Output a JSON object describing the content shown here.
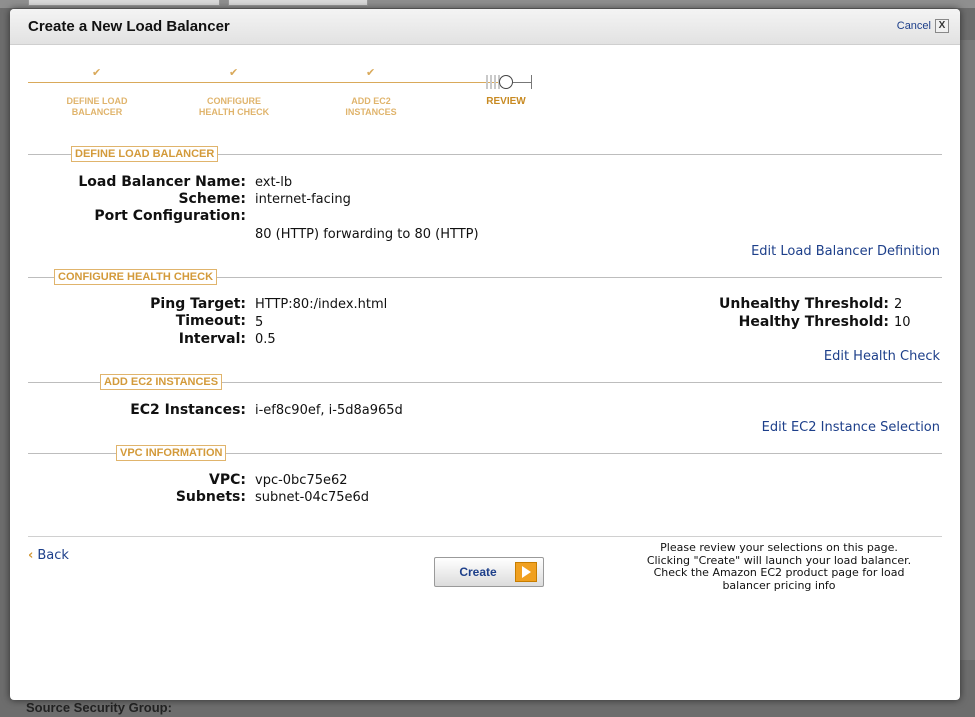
{
  "dialog": {
    "title": "Create a New Load Balancer",
    "cancel_label": "Cancel",
    "close_glyph": "X"
  },
  "wizard": {
    "steps": [
      {
        "label_line1": "DEFINE LOAD",
        "label_line2": "BALANCER",
        "status": "complete",
        "check": "✔"
      },
      {
        "label_line1": "CONFIGURE",
        "label_line2": "HEALTH CHECK",
        "status": "complete",
        "check": "✔"
      },
      {
        "label_line1": "ADD EC2",
        "label_line2": "INSTANCES",
        "status": "complete",
        "check": "✔"
      },
      {
        "label_line1": "REVIEW",
        "label_line2": "",
        "status": "current"
      }
    ]
  },
  "sections": {
    "define": {
      "title": "DEFINE LOAD BALANCER",
      "name_label": "Load Balancer Name:",
      "name_value": "ext-lb",
      "scheme_label": "Scheme:",
      "scheme_value": "internet-facing",
      "port_label": "Port Configuration:",
      "port_value": "80 (HTTP) forwarding to 80 (HTTP)",
      "edit_link": "Edit Load Balancer Definition"
    },
    "health": {
      "title": "CONFIGURE HEALTH CHECK",
      "ping_label": "Ping Target:",
      "ping_value": "HTTP:80:/index.html",
      "timeout_label": "Timeout:",
      "timeout_value": "5",
      "interval_label": "Interval:",
      "interval_value": "0.5",
      "unhealthy_label": "Unhealthy Threshold:",
      "unhealthy_value": "2",
      "healthy_label": "Healthy Threshold:",
      "healthy_value": "10",
      "edit_link": "Edit Health Check"
    },
    "instances": {
      "title": "ADD EC2 INSTANCES",
      "label": "EC2 Instances:",
      "value": "i-ef8c90ef, i-5d8a965d",
      "edit_link": "Edit EC2 Instance Selection"
    },
    "vpc": {
      "title": "VPC INFORMATION",
      "vpc_label": "VPC:",
      "vpc_value": "vpc-0bc75e62",
      "subnets_label": "Subnets:",
      "subnets_value": "subnet-04c75e6d"
    }
  },
  "footer": {
    "back_label": "Back",
    "back_glyph": "‹",
    "create_label": "Create",
    "note_lines": [
      "Please review your selections on this page.",
      "Clicking \"Create\" will launch your load balancer.",
      "Check the Amazon EC2 product page for load",
      "balancer pricing info"
    ]
  },
  "background": {
    "footer_text": "Source Security Group:"
  },
  "colors": {
    "accent_orange": "#d39a3a",
    "link_blue": "#1d3f8a",
    "button_arrow": "#f0a020"
  },
  "icons": [
    "checkmark-icon",
    "close-icon",
    "chevron-left-icon",
    "arrow-right-icon",
    "current-step-circle-icon"
  ]
}
